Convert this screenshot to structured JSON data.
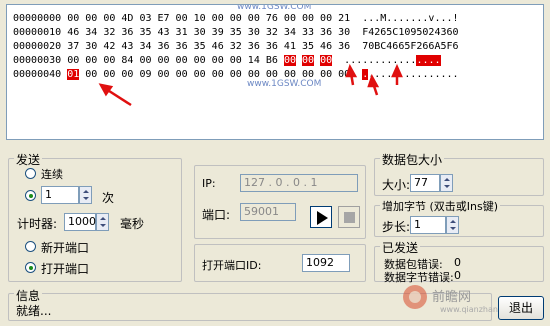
{
  "hex": {
    "watermark_top": "www.1GSW.COM",
    "watermark_bottom": "www.1GSW.COM",
    "lines": [
      {
        "addr": "00000000",
        "bytes": " 00 00 00 4D 03 E7 00 10 00 00 00 76 00 00 00 21",
        "ascii": "  ...M.......v...!"
      },
      {
        "addr": "00000010",
        "bytes": " 46 34 32 36 35 43 31 30 39 35 30 32 34 33 36 30",
        "ascii": "  F4265C1095024360"
      },
      {
        "addr": "00000020",
        "bytes": " 37 30 42 43 34 36 36 35 46 32 36 36 41 35 46 36",
        "ascii": "  70BC4665F266A5F6"
      },
      {
        "addr": "00000030",
        "pre": " 00 00 00 84 00 00 00 00 00 00 14 B6 ",
        "h1": "00",
        "mid1": " ",
        "h2": "00",
        "mid2": " ",
        "h3": "00",
        "post": "",
        "ascii_pre": "  ............",
        "ascii_hl": "....",
        "ascii_post": ""
      },
      {
        "addr": "00000040",
        "pre": " ",
        "h1": "01",
        "post": " 00 00 00 09 00 00 00 00 00 00 00 00 00 00 00",
        "ascii_pre": "  ",
        "ascii_hl": ".",
        "ascii_post": "..............."
      }
    ]
  },
  "send": {
    "title": "发送",
    "continuous_label": "连续",
    "count_value": "1",
    "times_label": "次",
    "timer_label": "计时器:",
    "timer_value": "1000",
    "ms_label": "毫秒",
    "new_port_label": "新开端口",
    "open_port_label": "打开端口"
  },
  "net": {
    "ip_label": "IP:",
    "ip_value": "127 . 0 . 0 . 1",
    "port_label": "端口:",
    "port_value": "59001",
    "open_port_id_label": "打开端口ID:",
    "open_port_id_value": "1092"
  },
  "packet_size": {
    "title": "数据包大小",
    "size_label": "大小:",
    "size_value": "77",
    "increase_title": "增加字节 (双击或Ins键)",
    "step_label": "步长:",
    "step_value": "1"
  },
  "sent": {
    "title": "已发送",
    "packet_error_label": "数据包错误:",
    "packet_error_value": "0",
    "byte_error_label": "数据字节错误:",
    "byte_error_value": "0"
  },
  "info": {
    "title": "信息",
    "status": "就绪..."
  },
  "exit_label": "退出",
  "watermark": {
    "brand": "前瞻网",
    "url": "www.qianzhan.com"
  }
}
